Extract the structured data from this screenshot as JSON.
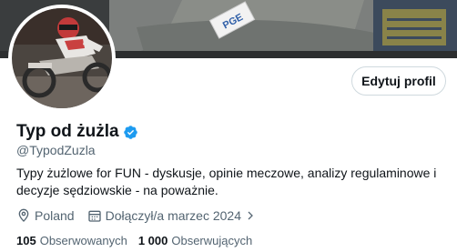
{
  "profile": {
    "name": "Typ od żużla",
    "handle": "@TypodZuzla",
    "bio": "Typy żużlowe for FUN - dyskusje, opinie meczowe, analizy regulaminowe i decyzje sędziowskie - na poważnie.",
    "location": "Poland",
    "joined": "Dołączył/a marzec 2024",
    "edit_button": "Edytuj profil",
    "following_count": "105",
    "following_label": "Obserwowanych",
    "followers_count": "1 000",
    "followers_label": "Obserwujących",
    "banner_logo_text": "PGE"
  },
  "colors": {
    "verified": "#1d9bf0",
    "secondary_text": "#536471",
    "primary_text": "#0f1419"
  }
}
